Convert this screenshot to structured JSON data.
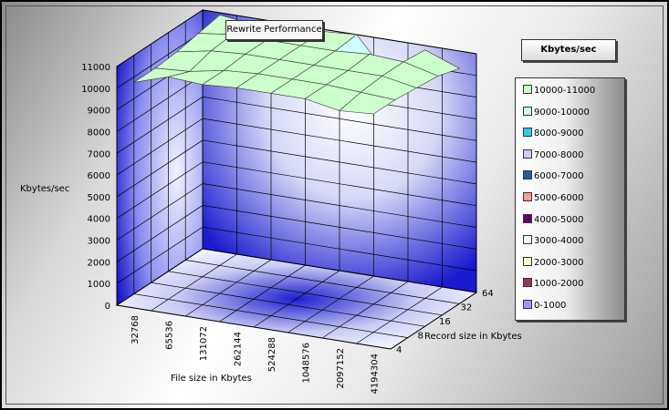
{
  "chart_data": {
    "type": "surface",
    "title": "Rewrite Performance",
    "ylabel": "Kbytes/sec",
    "xlabel": "File size in Kbytes",
    "zlabel": "Record size in Kbytes",
    "ylim": [
      0,
      11000
    ],
    "y_ticks": [
      "0",
      "1000",
      "2000",
      "3000",
      "4000",
      "5000",
      "6000",
      "7000",
      "8000",
      "9000",
      "10000",
      "11000"
    ],
    "x_categories": [
      "32768",
      "65536",
      "131072",
      "262144",
      "524288",
      "1048576",
      "2097152",
      "4194304"
    ],
    "z_categories": [
      "4",
      "8",
      "16",
      "32",
      "64"
    ],
    "legend_title": "Kbytes/sec",
    "legend": [
      {
        "label": "10000-11000",
        "color": "#ccffcc"
      },
      {
        "label": "9000-10000",
        "color": "#ccffff"
      },
      {
        "label": "8000-9000",
        "color": "#33ccee"
      },
      {
        "label": "7000-8000",
        "color": "#ccccff"
      },
      {
        "label": "6000-7000",
        "color": "#1f5fa8"
      },
      {
        "label": "5000-6000",
        "color": "#ff9999"
      },
      {
        "label": "4000-5000",
        "color": "#660066"
      },
      {
        "label": "3000-4000",
        "color": "#e6ffff"
      },
      {
        "label": "2000-3000",
        "color": "#ffffcc"
      },
      {
        "label": "1000-2000",
        "color": "#993366"
      },
      {
        "label": "0-1000",
        "color": "#9999ff"
      }
    ],
    "values": [
      [
        10400,
        10900,
        10800,
        10900,
        10900,
        10900,
        10600,
        10700
      ],
      [
        10400,
        10500,
        10800,
        10900,
        10900,
        10900,
        10800,
        10700
      ],
      [
        10500,
        10800,
        10900,
        10900,
        10900,
        10900,
        10900,
        10600
      ],
      [
        10700,
        10900,
        10900,
        10900,
        10900,
        11000,
        10900,
        10500
      ],
      [
        10900,
        10700,
        10900,
        10900,
        11000,
        9200,
        10800,
        10200
      ]
    ]
  }
}
